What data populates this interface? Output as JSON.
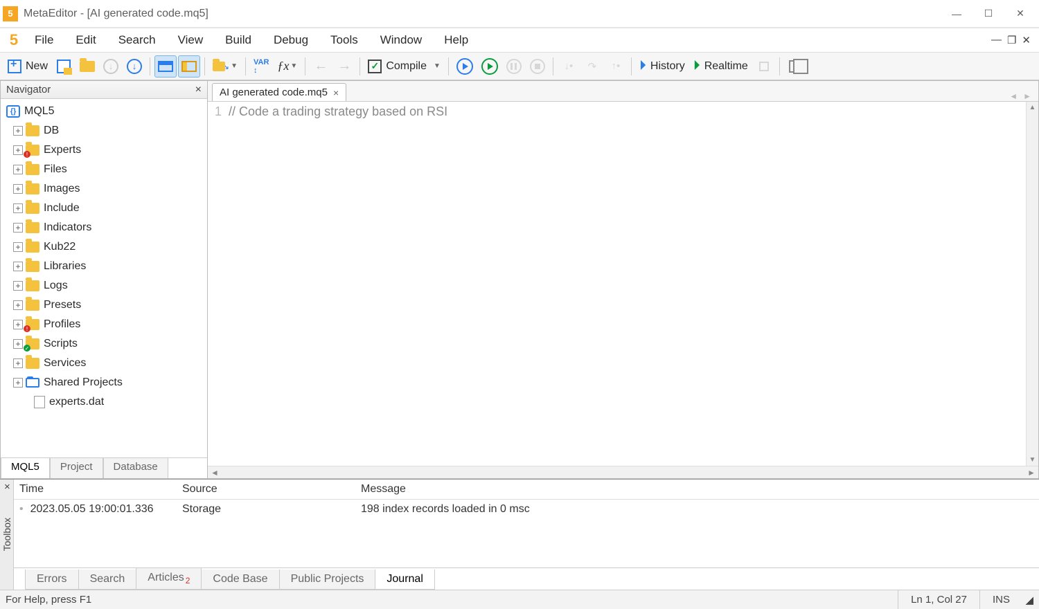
{
  "titlebar": {
    "text": "MetaEditor - [AI generated code.mq5]"
  },
  "menu": {
    "items": [
      "File",
      "Edit",
      "Search",
      "View",
      "Build",
      "Debug",
      "Tools",
      "Window",
      "Help"
    ]
  },
  "toolbar": {
    "new": "New",
    "compile": "Compile",
    "history": "History",
    "realtime": "Realtime"
  },
  "navigator": {
    "title": "Navigator",
    "root": "MQL5",
    "children": [
      {
        "label": "DB"
      },
      {
        "label": "Experts",
        "badge": "red"
      },
      {
        "label": "Files"
      },
      {
        "label": "Images"
      },
      {
        "label": "Include"
      },
      {
        "label": "Indicators"
      },
      {
        "label": "Kub22"
      },
      {
        "label": "Libraries"
      },
      {
        "label": "Logs"
      },
      {
        "label": "Presets"
      },
      {
        "label": "Profiles",
        "badge": "red"
      },
      {
        "label": "Scripts",
        "badge": "green"
      },
      {
        "label": "Services"
      },
      {
        "label": "Shared Projects",
        "shared": true
      }
    ],
    "file": "experts.dat",
    "tabs": [
      "MQL5",
      "Project",
      "Database"
    ]
  },
  "editor": {
    "tab": "AI generated code.mq5",
    "line_no": "1",
    "code": "// Code a trading strategy based on RSI"
  },
  "toolbox": {
    "label": "Toolbox",
    "headers": {
      "time": "Time",
      "source": "Source",
      "message": "Message"
    },
    "row": {
      "time": "2023.05.05 19:00:01.336",
      "source": "Storage",
      "message": "198 index records loaded in 0 msc"
    },
    "tabs": [
      "Errors",
      "Search",
      "Articles",
      "Code Base",
      "Public Projects",
      "Journal"
    ],
    "articles_badge": "2",
    "active_tab": "Journal"
  },
  "status": {
    "help": "For Help, press F1",
    "pos": "Ln 1, Col 27",
    "ins": "INS"
  }
}
